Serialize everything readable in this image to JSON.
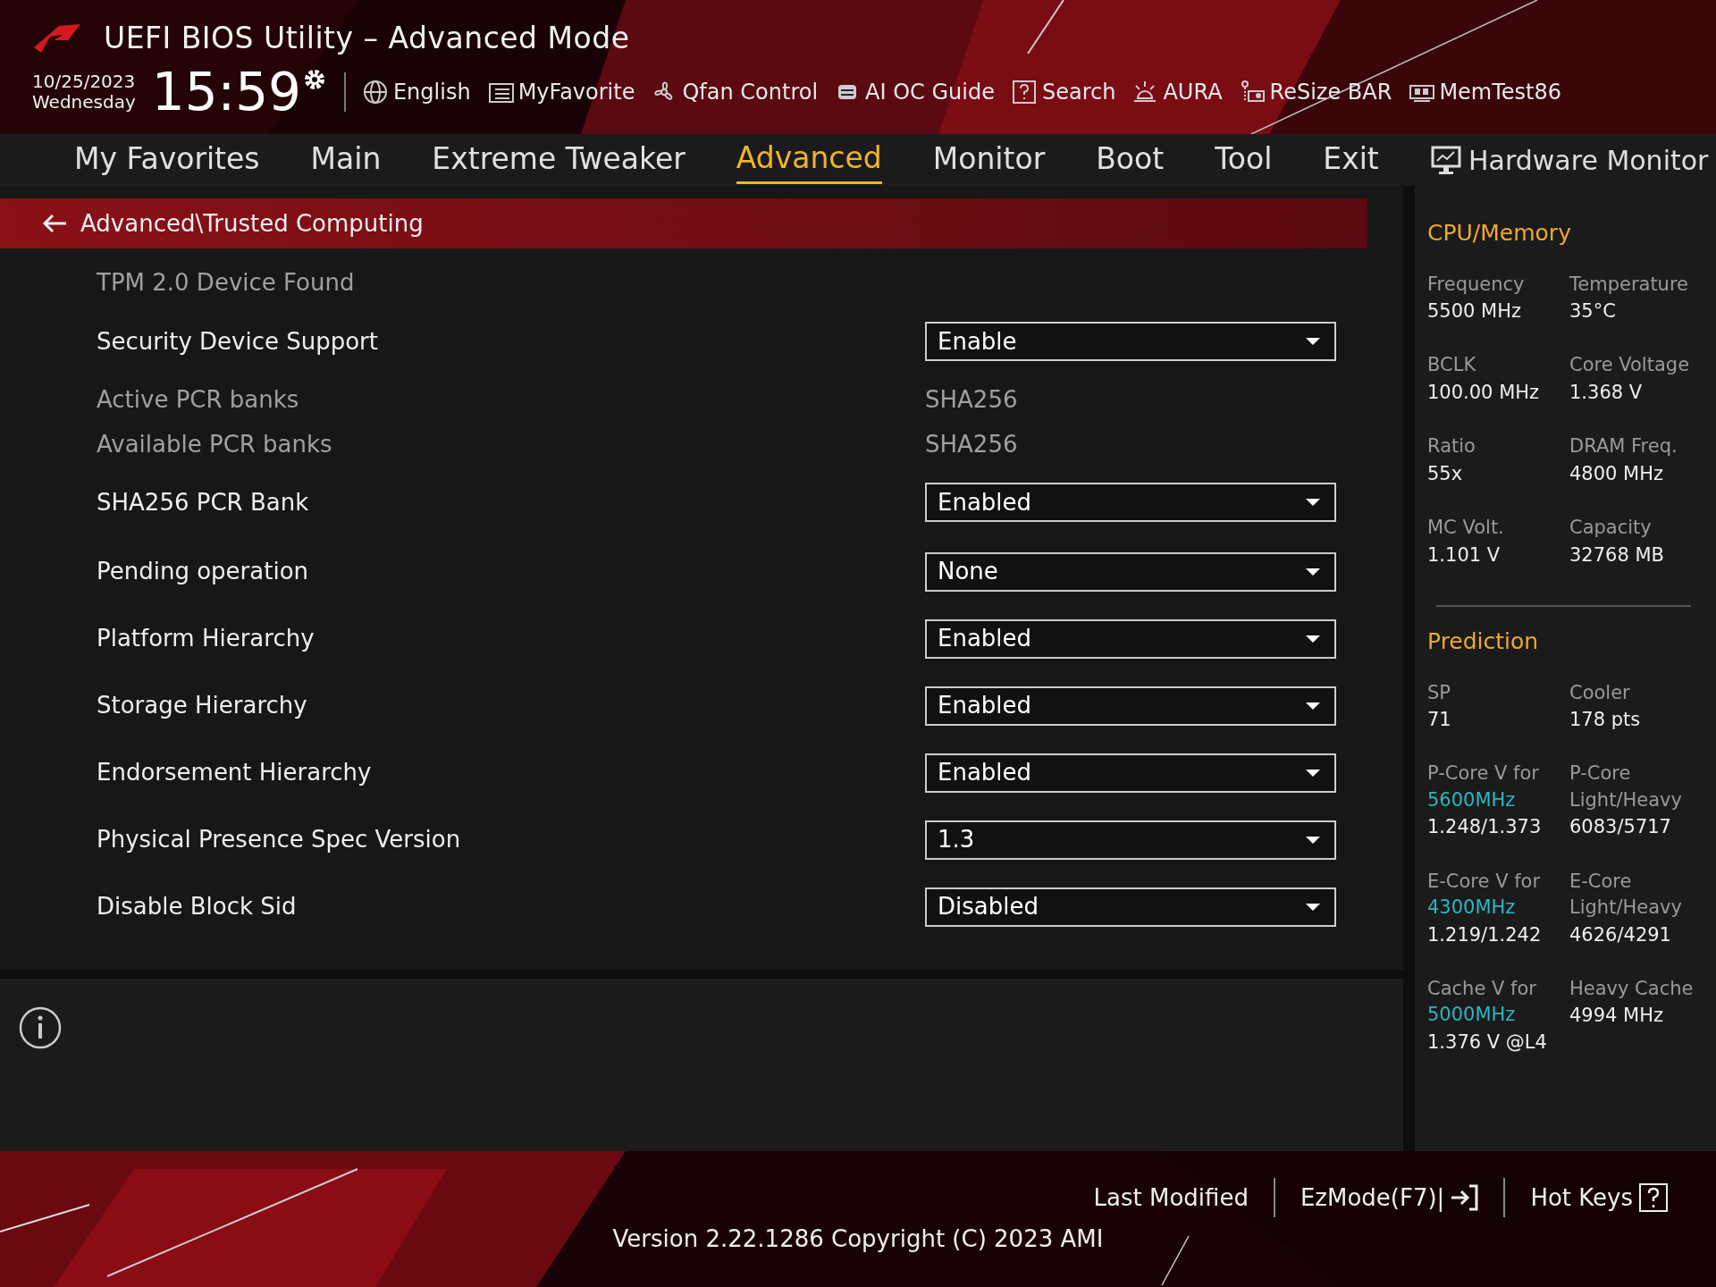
{
  "header": {
    "title": "UEFI BIOS Utility – Advanced Mode",
    "date": "10/25/2023",
    "day": "Wednesday",
    "time": "15:59",
    "toolbar": [
      {
        "label": "English",
        "kind": "globe"
      },
      {
        "label": "MyFavorite",
        "kind": "favorite"
      },
      {
        "label": "Qfan Control",
        "kind": "fan"
      },
      {
        "label": "AI OC Guide",
        "kind": "chip"
      },
      {
        "label": "Search",
        "kind": "help"
      },
      {
        "label": "AURA",
        "kind": "aura"
      },
      {
        "label": "ReSize BAR",
        "kind": "card"
      },
      {
        "label": "MemTest86",
        "kind": "memory"
      }
    ]
  },
  "menu_tabs": [
    {
      "label": "My Favorites",
      "selected": false
    },
    {
      "label": "Main",
      "selected": false
    },
    {
      "label": "Extreme Tweaker",
      "selected": false
    },
    {
      "label": "Advanced",
      "selected": true
    },
    {
      "label": "Monitor",
      "selected": false
    },
    {
      "label": "Boot",
      "selected": false
    },
    {
      "label": "Tool",
      "selected": false
    },
    {
      "label": "Exit",
      "selected": false
    }
  ],
  "breadcrumb": "Advanced\\Trusted Computing",
  "settings": [
    {
      "kind": "note",
      "label": "TPM 2.0 Device Found"
    },
    {
      "kind": "dropdown",
      "label": "Security Device Support",
      "value": "Enable"
    },
    {
      "kind": "info",
      "label": "Active PCR banks",
      "value": "SHA256"
    },
    {
      "kind": "info",
      "label": "Available PCR banks",
      "value": "SHA256"
    },
    {
      "kind": "dropdown",
      "label": "SHA256 PCR Bank",
      "value": "Enabled"
    },
    {
      "kind": "dropdown",
      "label": "Pending operation",
      "value": "None"
    },
    {
      "kind": "dropdown",
      "label": "Platform Hierarchy",
      "value": "Enabled"
    },
    {
      "kind": "dropdown",
      "label": "Storage Hierarchy",
      "value": "Enabled"
    },
    {
      "kind": "dropdown",
      "label": "Endorsement Hierarchy",
      "value": "Enabled"
    },
    {
      "kind": "dropdown",
      "label": "Physical Presence Spec Version",
      "value": "1.3"
    },
    {
      "kind": "dropdown",
      "label": "Disable Block Sid",
      "value": "Disabled"
    }
  ],
  "hardware_monitor": {
    "title": "Hardware Monitor",
    "sections": [
      {
        "title": "CPU/Memory",
        "items": [
          {
            "label": "Frequency",
            "value": "5500 MHz"
          },
          {
            "label": "Temperature",
            "value": "35°C"
          },
          {
            "label": "BCLK",
            "value": "100.00 MHz"
          },
          {
            "label": "Core Voltage",
            "value": "1.368 V"
          },
          {
            "label": "Ratio",
            "value": "55x"
          },
          {
            "label": "DRAM Freq.",
            "value": "4800 MHz"
          },
          {
            "label": "MC Volt.",
            "value": "1.101 V"
          },
          {
            "label": "Capacity",
            "value": "32768 MB"
          }
        ]
      },
      {
        "title": "Prediction",
        "items": [
          {
            "label": "SP",
            "value": "71"
          },
          {
            "label": "Cooler",
            "value": "178 pts"
          },
          {
            "label": "P-Core V for",
            "freq": "5600MHz",
            "value": "1.248/1.373"
          },
          {
            "label": "P-Core Light/Heavy",
            "value": "6083/5717"
          },
          {
            "label": "E-Core V for",
            "freq": "4300MHz",
            "value": "1.219/1.242"
          },
          {
            "label": "E-Core Light/Heavy",
            "value": "4626/4291"
          },
          {
            "label": "Cache V for",
            "freq": "5000MHz",
            "value": "1.376 V @L4"
          },
          {
            "label": "Heavy Cache",
            "value": "4994 MHz"
          }
        ]
      }
    ]
  },
  "footer": {
    "buttons": [
      {
        "label": "Last Modified",
        "kind": "plain"
      },
      {
        "label": "EzMode(F7)|",
        "kind": "exit"
      },
      {
        "label": "Hot Keys",
        "kind": "help"
      }
    ],
    "version": "Version 2.22.1286 Copyright (C) 2023 AMI"
  }
}
